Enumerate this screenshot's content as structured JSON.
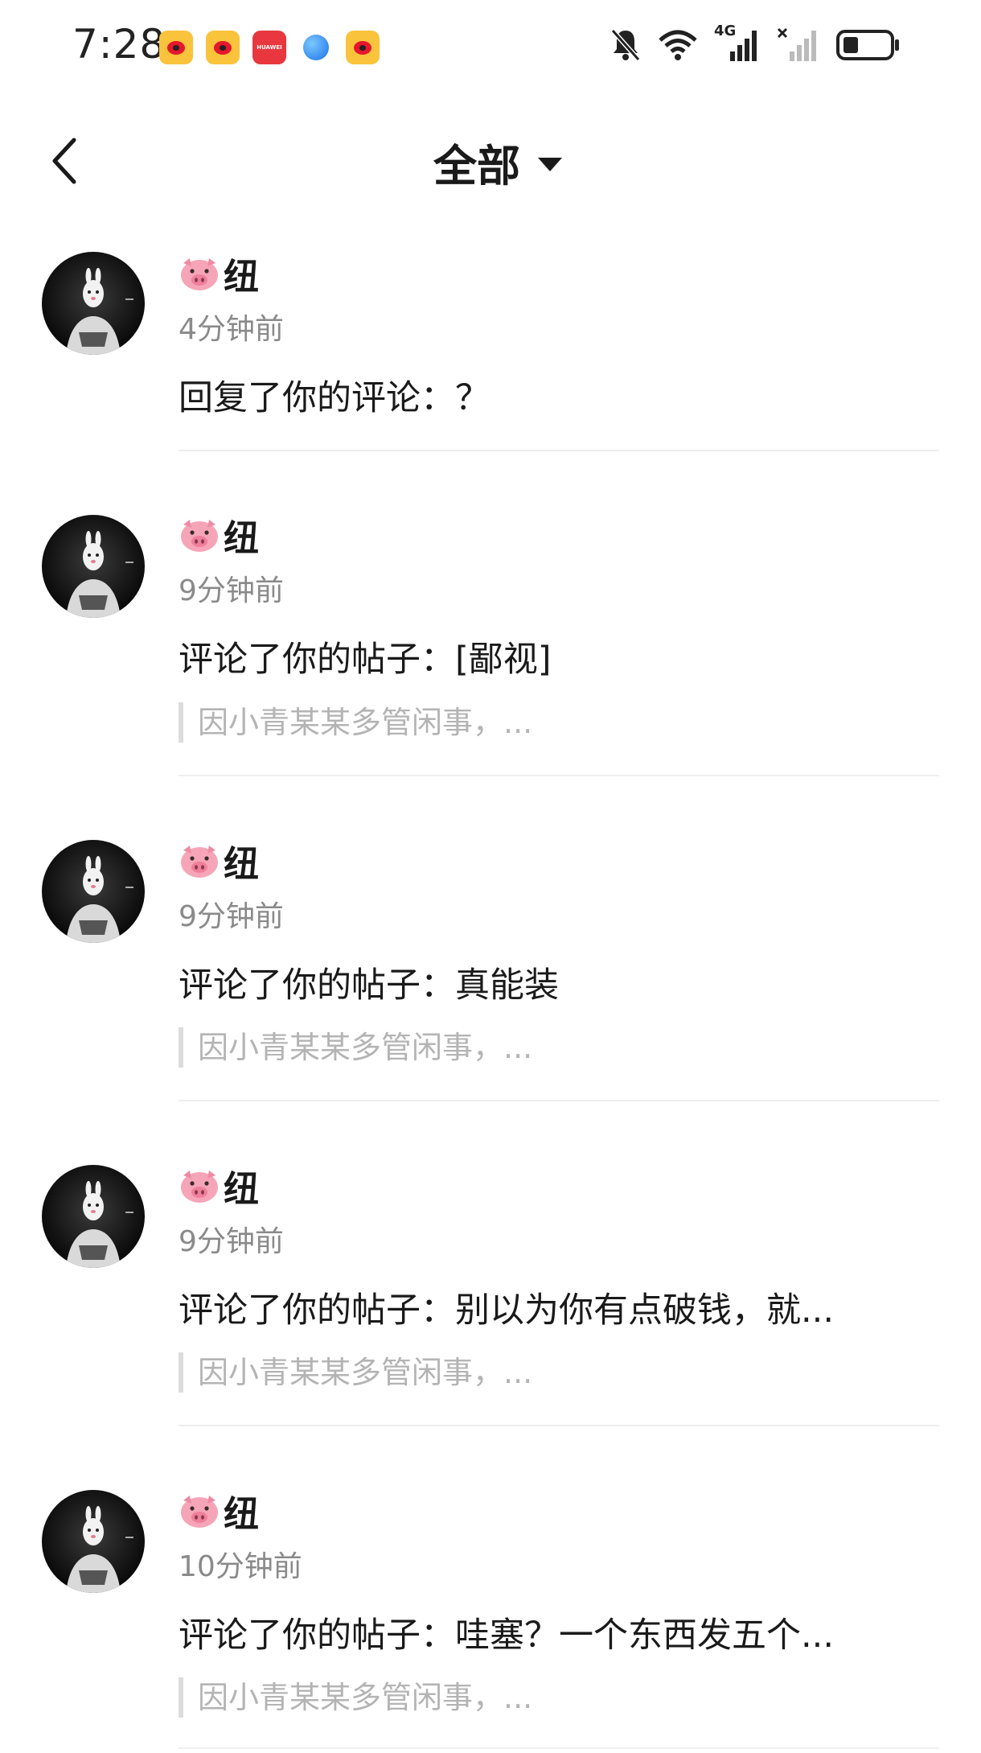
{
  "status_bar": {
    "time": "7:28",
    "notification_icons": [
      "weibo-icon",
      "weibo-icon",
      "huawei-appgallery-icon",
      "browser-icon",
      "weibo-icon"
    ],
    "huawei_label": "HUAWEI",
    "system_icons": [
      "bell-muted-icon",
      "wifi-icon",
      "signal-4g-icon",
      "signal-no-service-icon",
      "battery-icon"
    ],
    "network_label": "4G"
  },
  "header": {
    "back_icon": "chevron-left-icon",
    "title": "全部",
    "dropdown_icon": "caret-down-icon"
  },
  "notifications": [
    {
      "user": "纽",
      "time": "4分钟前",
      "content": "回复了你的评论：？",
      "quote": ""
    },
    {
      "user": "纽",
      "time": "9分钟前",
      "content": "评论了你的帖子：[鄙视]",
      "quote": "因小青某某多管闲事，..."
    },
    {
      "user": "纽",
      "time": "9分钟前",
      "content": "评论了你的帖子：真能装",
      "quote": "因小青某某多管闲事，..."
    },
    {
      "user": "纽",
      "time": "9分钟前",
      "content": "评论了你的帖子：别以为你有点破钱，就...",
      "quote": "因小青某某多管闲事，..."
    },
    {
      "user": "纽",
      "time": "10分钟前",
      "content": "评论了你的帖子：哇塞？一个东西发五个...",
      "quote": "因小青某某多管闲事，..."
    }
  ],
  "colors": {
    "text_primary": "#1a1a1a",
    "text_secondary": "#8a8a8a",
    "text_quote": "#b4b4b4",
    "divider": "#eeeeee",
    "quote_bar": "#dcdcdc"
  }
}
